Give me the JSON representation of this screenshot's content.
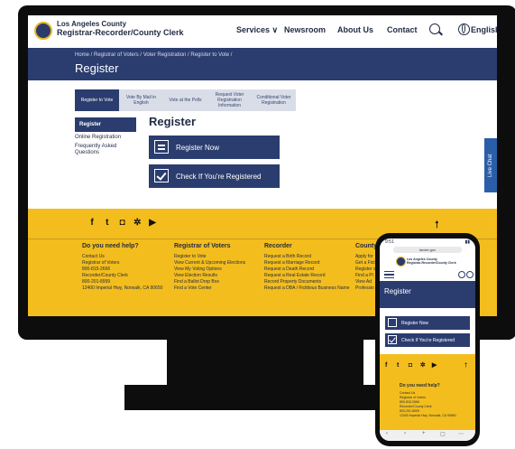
{
  "desktop": {
    "header": {
      "brand_line1": "Los Angeles County",
      "brand_line2": "Registrar-Recorder/County Clerk",
      "nav": [
        "Services ∨",
        "Newsroom",
        "About Us",
        "Contact"
      ],
      "language": "English"
    },
    "breadcrumb": "Home  /  Registrar of Voters  /  Voter Registration  /  Register to Vote  /",
    "page_title": "Register",
    "tabs": [
      "Register to Vote",
      "Vote By Mail in English",
      "Vote at the Polls",
      "Request Voter Registration Information",
      "Conditional Voter Registration"
    ],
    "sidebar": {
      "active": "Register",
      "items": [
        "Online Registration",
        "Frequently Asked Questions"
      ]
    },
    "section_title": "Register",
    "buttons": [
      "Register Now",
      "Check If You're Registered"
    ],
    "live_chat": "Live Chat",
    "footer": {
      "social": [
        "f",
        "t",
        "◘",
        "✲",
        "▶"
      ],
      "columns": [
        {
          "heading": "Do you need help?",
          "lines": [
            "Contact Us",
            "",
            "Registrar of Voters",
            "800-815-2666",
            "",
            "Recorder/County Clerk",
            "800-201-8999",
            "",
            "12400 Imperial Hwy, Norwalk, CA 90650"
          ]
        },
        {
          "heading": "Registrar of Voters",
          "lines": [
            "Register to Vote",
            "View Current & Upcoming Elections",
            "View My Voting Options",
            "View Election Results",
            "Find a Ballot Drop Box",
            "Find a Vote Center"
          ]
        },
        {
          "heading": "Recorder",
          "lines": [
            "Request a Birth Record",
            "Request a Marriage Record",
            "Request a Death Record",
            "Request a Real Estate Record",
            "Record Property Documents",
            "Request a DBA / Fictitious Business Name"
          ]
        },
        {
          "heading": "County",
          "lines": [
            "Apply for",
            "Get a Fict",
            "Register a",
            "Find a Pl",
            "View Ad",
            "Professio"
          ]
        }
      ]
    }
  },
  "phone": {
    "status_time": "9:51",
    "url": "lavote.gov",
    "brand_line1": "Los Angeles County",
    "brand_line2": "Registrar-Recorder/County Clerk",
    "page_title": "Register",
    "buttons": [
      "Register Now",
      "Check If You're Registered"
    ],
    "footer": {
      "social": [
        "f",
        "t",
        "◘",
        "✲",
        "▶"
      ],
      "heading": "Do you need help?",
      "lines": [
        "Contact Us",
        "",
        "Registrar of Voters",
        "800-815-2666",
        "",
        "Recorder/County Clerk",
        "800-201-8999",
        "",
        "12400 Imperial Hwy, Norwalk, CA 90650"
      ]
    }
  },
  "colors": {
    "navy": "#2b3d6f",
    "gold": "#f3bd1d",
    "bezel": "#0d0d0d"
  }
}
